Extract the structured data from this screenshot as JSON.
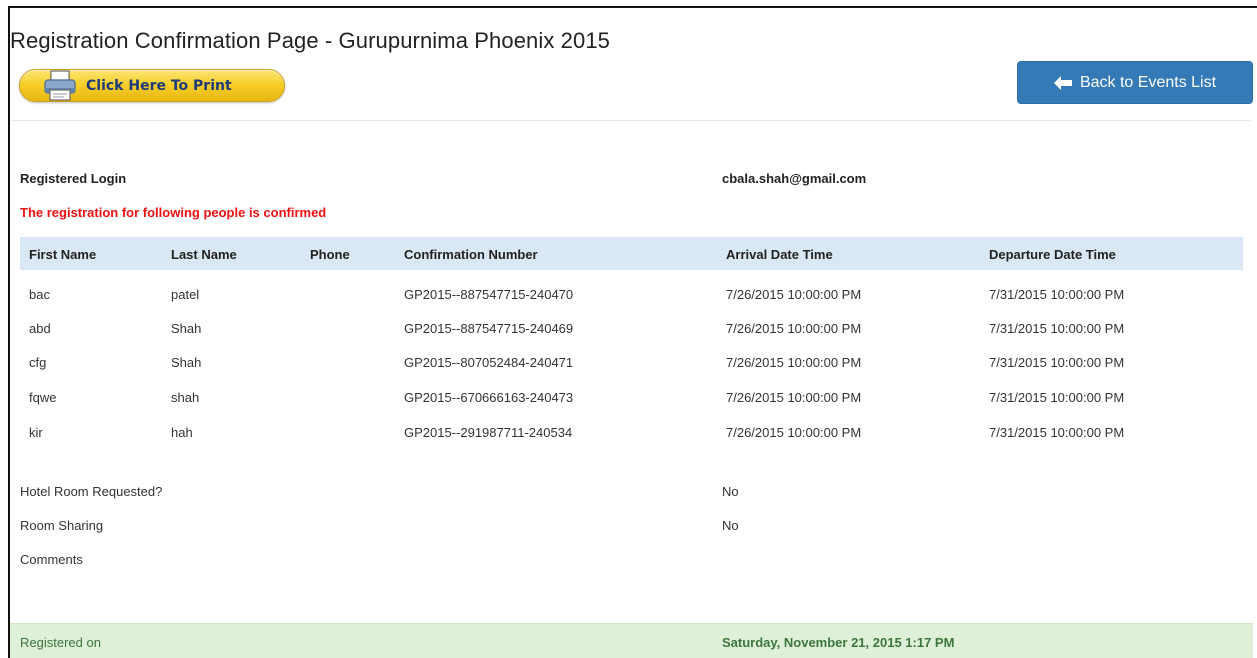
{
  "page": {
    "title": "Registration Confirmation Page - Gurupurnima Phoenix 2015"
  },
  "actions": {
    "print_label": "Click Here To Print",
    "back_label": "Back to Events List"
  },
  "registration": {
    "login_label": "Registered Login",
    "login_value": "cbala.shah@gmail.com",
    "confirmed_message": "The registration for following people is confirmed"
  },
  "table": {
    "headers": [
      "First Name",
      "Last Name",
      "Phone",
      "Confirmation Number",
      "Arrival Date Time",
      "Departure Date Time"
    ],
    "rows": [
      {
        "first": "bac",
        "last": "patel",
        "phone": "",
        "confirmation": "GP2015--887547715-240470",
        "arrival": "7/26/2015 10:00:00 PM",
        "departure": "7/31/2015 10:00:00 PM"
      },
      {
        "first": "abd",
        "last": "Shah",
        "phone": "",
        "confirmation": "GP2015--887547715-240469",
        "arrival": "7/26/2015 10:00:00 PM",
        "departure": "7/31/2015 10:00:00 PM"
      },
      {
        "first": "cfg",
        "last": "Shah",
        "phone": "",
        "confirmation": "GP2015--807052484-240471",
        "arrival": "7/26/2015 10:00:00 PM",
        "departure": "7/31/2015 10:00:00 PM"
      },
      {
        "first": "fqwe",
        "last": "shah",
        "phone": "",
        "confirmation": "GP2015--670666163-240473",
        "arrival": "7/26/2015 10:00:00 PM",
        "departure": "7/31/2015 10:00:00 PM"
      },
      {
        "first": "kir",
        "last": "hah",
        "phone": "",
        "confirmation": "GP2015--291987711-240534",
        "arrival": "7/26/2015 10:00:00 PM",
        "departure": "7/31/2015 10:00:00 PM"
      }
    ]
  },
  "details": {
    "hotel_label": "Hotel Room Requested?",
    "hotel_value": "No",
    "sharing_label": "Room Sharing",
    "sharing_value": "No",
    "comments_label": "Comments",
    "comments_value": ""
  },
  "footer": {
    "registered_on_label": "Registered on",
    "registered_on_value": "Saturday, November 21, 2015 1:17 PM"
  },
  "colors": {
    "primary_button": "#337ab7",
    "print_button": "#f7cf2c",
    "alert_text": "#ee1111",
    "table_header_bg": "#d9e8f4",
    "footer_bg": "#dff0d8"
  },
  "icons": {
    "print": "printer-icon",
    "back": "arrow-left-icon"
  }
}
